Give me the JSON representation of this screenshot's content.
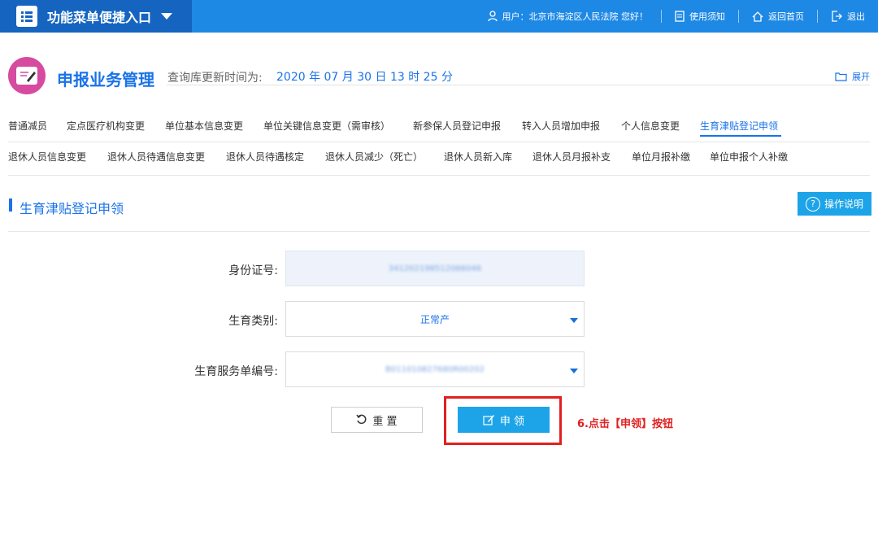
{
  "topbar": {
    "menu_title": "功能菜单便捷入口",
    "user_text": "用户：北京市海淀区人民法院 您好！",
    "links": [
      "使用须知",
      "返回首页",
      "退出"
    ]
  },
  "header": {
    "title": "申报业务管理",
    "update_label": "查询库更新时间为:",
    "update_value": "2020 年 07 月 30 日 13 时 25 分",
    "expand_label": "展开"
  },
  "tabs_row1": [
    "普通减员",
    "定点医疗机构变更",
    "单位基本信息变更",
    "单位关键信息变更（需审核）",
    "新参保人员登记申报",
    "转入人员增加申报",
    "个人信息变更",
    "生育津贴登记申领"
  ],
  "tabs_row2": [
    "退休人员信息变更",
    "退休人员待遇信息变更",
    "退休人员待遇核定",
    "退休人员减少（死亡）",
    "退休人员新入库",
    "退休人员月报补支",
    "单位月报补缴",
    "单位申报个人补缴"
  ],
  "section": {
    "title": "生育津贴登记申领",
    "help_label": "操作说明"
  },
  "form": {
    "id_label": "身份证号:",
    "id_value": "341202198512066046",
    "type_label": "生育类别:",
    "type_value": "正常产",
    "service_label": "生育服务单编号:",
    "service_value": "B011010827680R00202",
    "reset_label": "重 置",
    "apply_label": "申 领"
  },
  "annotation": "6.点击【申领】按钮",
  "colors": {
    "topbar": "#1e88e5",
    "accent": "#1a73e8",
    "button": "#1da4e8",
    "highlight": "#e02020"
  }
}
